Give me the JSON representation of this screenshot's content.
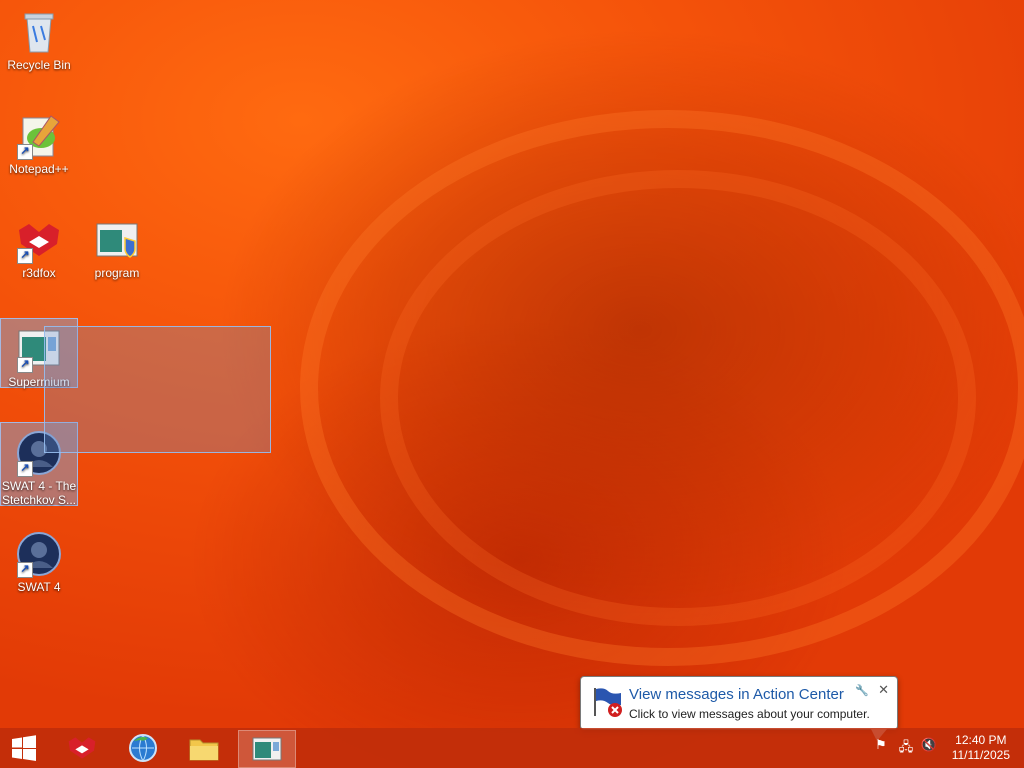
{
  "desktop": {
    "icons": [
      {
        "label": "Recycle Bin",
        "icon": "recycle-bin-icon"
      },
      {
        "label": "Notepad++",
        "icon": "notepad-plus-plus-icon"
      },
      {
        "label": "r3dfox",
        "icon": "r3dfox-icon"
      },
      {
        "label": "program",
        "icon": "program-icon"
      },
      {
        "label": "Supermium",
        "icon": "supermium-icon"
      },
      {
        "label": "SWAT 4 - The Stetchkov S...",
        "icon": "swat4-expansion-icon"
      },
      {
        "label": "SWAT 4",
        "icon": "swat4-icon"
      }
    ]
  },
  "balloon": {
    "title": "View messages in Action Center",
    "text": "Click to view messages about your computer.",
    "close": "✕",
    "icon": "action-center-flag-icon"
  },
  "taskbar": {
    "buttons": [
      {
        "name": "start",
        "icon": "windows-start-icon"
      },
      {
        "name": "r3dfox",
        "icon": "r3dfox-icon"
      },
      {
        "name": "browser",
        "icon": "globe-browser-icon"
      },
      {
        "name": "file-explorer",
        "icon": "folder-icon"
      },
      {
        "name": "program",
        "icon": "program-window-icon"
      }
    ],
    "clock": {
      "time": "12:40 PM",
      "date": "11/11/2025"
    }
  },
  "colors": {
    "wallpaper_accent": "#f4520a",
    "taskbar": "#be2d0a",
    "balloon_title": "#1e5aa8"
  }
}
